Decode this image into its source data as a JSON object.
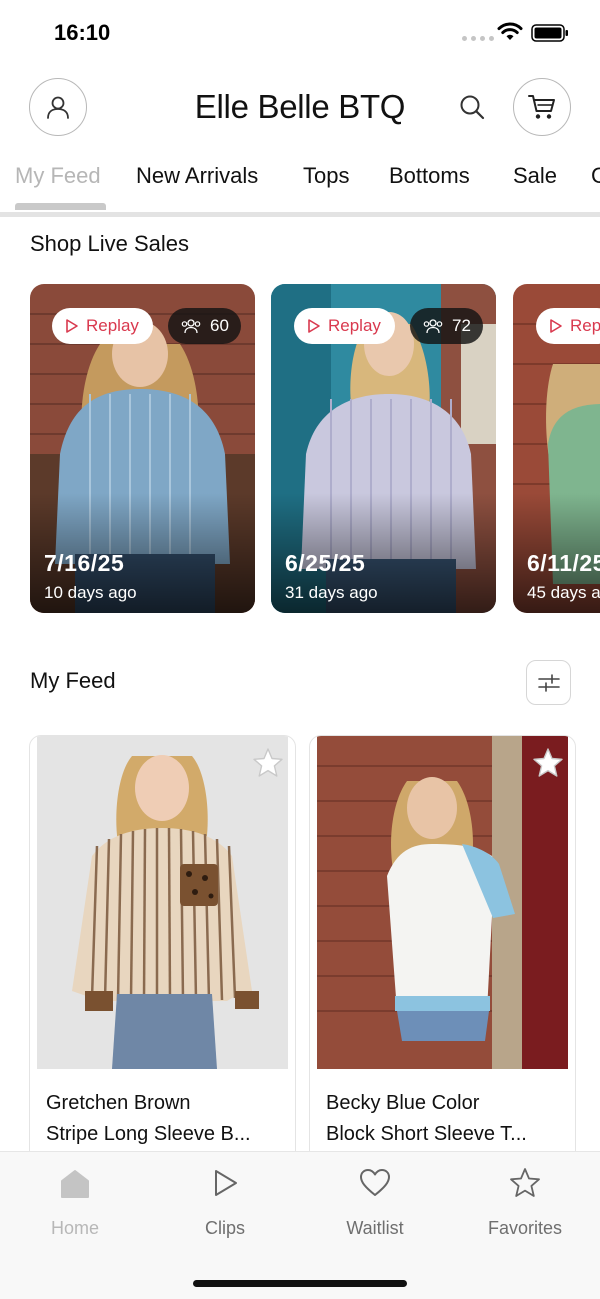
{
  "status_bar": {
    "time": "16:10",
    "icons": [
      "signal-dots",
      "wifi-icon",
      "battery-icon"
    ]
  },
  "header": {
    "title": "Elle Belle BTQ",
    "icons": [
      "account-icon",
      "search-icon",
      "cart-icon"
    ]
  },
  "tabs": {
    "items": [
      {
        "label": "My Feed",
        "active": true
      },
      {
        "label": "New Arrivals"
      },
      {
        "label": "Tops"
      },
      {
        "label": "Bottoms"
      },
      {
        "label": "Sale"
      },
      {
        "label": "C"
      }
    ]
  },
  "live_sales": {
    "title": "Shop Live Sales",
    "items": [
      {
        "replay_label": "Replay",
        "viewers": "60",
        "date": "7/16/25",
        "ago": "10 days ago"
      },
      {
        "replay_label": "Replay",
        "viewers": "72",
        "date": "6/25/25",
        "ago": "31 days ago"
      },
      {
        "replay_label": "Rep",
        "date": "6/11/25",
        "ago": "45 days a"
      }
    ]
  },
  "feed": {
    "title": "My Feed",
    "filter_icon": "sliders-icon",
    "products": [
      {
        "name_line1": "Gretchen Brown",
        "name_line2": "Stripe Long Sleeve B..."
      },
      {
        "name_line1": "Becky Blue Color",
        "name_line2": "Block Short Sleeve T..."
      }
    ]
  },
  "bottom_nav": {
    "items": [
      {
        "label": "Home",
        "icon": "home-icon",
        "active": true
      },
      {
        "label": "Clips",
        "icon": "play-icon"
      },
      {
        "label": "Waitlist",
        "icon": "heart-icon"
      },
      {
        "label": "Favorites",
        "icon": "star-icon"
      }
    ]
  },
  "colors": {
    "accent_red": "#d9394e",
    "inactive_tab": "#b6b6b6",
    "nav_label": "#6f6f6f"
  }
}
